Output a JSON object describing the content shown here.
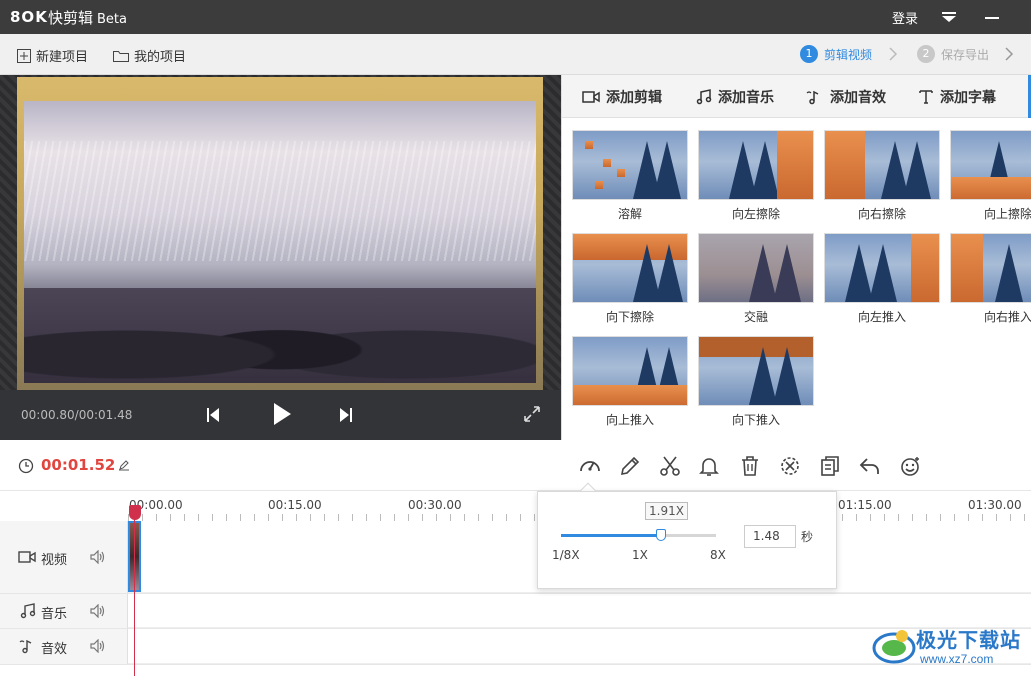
{
  "app": {
    "logo": "8OK",
    "name": "快剪辑",
    "edition": "Beta"
  },
  "titlebar": {
    "login": "登录"
  },
  "menubar": {
    "new_project": "新建项目",
    "my_projects": "我的项目",
    "steps": [
      {
        "num": "1",
        "label": "剪辑视频",
        "active": true
      },
      {
        "num": "2",
        "label": "保存导出",
        "active": false
      }
    ]
  },
  "preview": {
    "time": "00:00.80/00:01.48"
  },
  "tabs": [
    {
      "label": "添加剪辑",
      "icon": "video-camera-icon"
    },
    {
      "label": "添加音乐",
      "icon": "music-note-icon"
    },
    {
      "label": "添加音效",
      "icon": "sound-effect-icon"
    },
    {
      "label": "添加字幕",
      "icon": "text-icon"
    }
  ],
  "transitions": [
    "溶解",
    "向左擦除",
    "向右擦除",
    "向上擦除",
    "向下擦除",
    "交融",
    "向左推入",
    "向右推入",
    "向上推入",
    "向下推入"
  ],
  "toolbar": {
    "current_time": "00:01.52"
  },
  "timeline": {
    "ticks": [
      "00:00.00",
      "00:15.00",
      "00:30.00",
      "01:15.00",
      "01:30.00"
    ],
    "tracks": [
      {
        "label": "视频",
        "icon": "video-camera-icon"
      },
      {
        "label": "音乐",
        "icon": "music-note-icon"
      },
      {
        "label": "音效",
        "icon": "sound-effect-icon"
      }
    ]
  },
  "speed_popup": {
    "tooltip": "1.91X",
    "min_label": "1/8X",
    "mid_label": "1X",
    "max_label": "8X",
    "seconds_value": "1.48",
    "seconds_unit": "秒",
    "level_fraction": 0.64
  },
  "watermark": {
    "title": "极光下载站",
    "url": "www.xz7.com"
  },
  "colors": {
    "accent": "#2f8ae0",
    "time_red": "#e0463f",
    "playhead": "#d0304c"
  }
}
